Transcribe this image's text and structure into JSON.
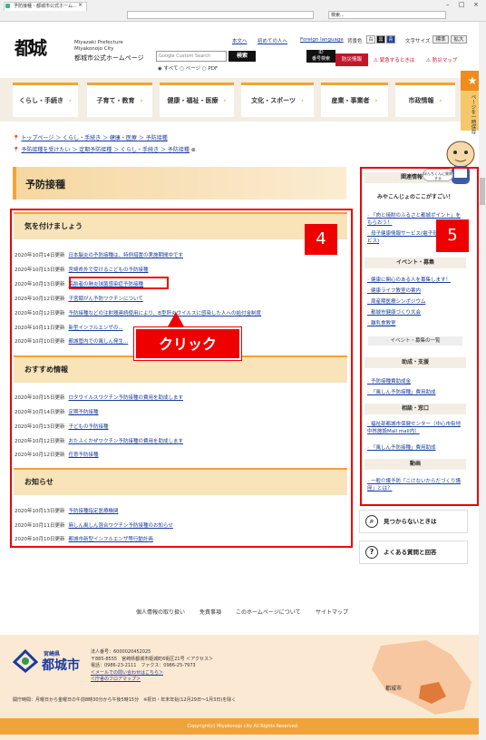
{
  "browser": {
    "tab_title": "予防接種 - 都城市公式ホーム...",
    "tab_close": "×",
    "address": "",
    "search_placeholder": "検索...",
    "window_buttons": [
      "–",
      "□",
      "×"
    ]
  },
  "header": {
    "logo_text": "都城",
    "pref_en": "Miyazaki Prefecture",
    "city_en": "Miyakonojo City",
    "site_title": "都城市公式ホームページ",
    "search_placeholder": "Google   Custom Search",
    "search_button": "検索",
    "radio_options": "◉ すべて  ○ ページ  ○ PDF",
    "id_button": "ID\n番号検索",
    "top_links": [
      "本文へ",
      "初めての人へ",
      "Foreign language"
    ],
    "bgcolor_label": "背景色",
    "bgcolor_options": [
      "白",
      "黒",
      "青"
    ],
    "fontsize_label": "文字サイズ",
    "fontsize_options": [
      "標準",
      "拡大"
    ],
    "bousai": "防災情報",
    "emergency": "緊急するときは",
    "bousai_map": "防災マップ"
  },
  "nav": {
    "items": [
      "くらし・手続き",
      "子育て・教育",
      "健康・福祉・医療",
      "文化・スポーツ",
      "産業・事業者",
      "市政情報"
    ],
    "page_top": "ページを一時保存"
  },
  "breadcrumb": {
    "line1": "トップページ ＞ くらし・手続き ＞ 健康・医療 ＞ 予防接種",
    "line2": "予防接種を受けたい ＞ 定期予防接種 ＞ くらし・手続き ＞ 予防接種"
  },
  "page_title": "予防接種",
  "sections": [
    {
      "heading": "気を付けましょう",
      "rows": [
        {
          "date": "2020年10月14日更新",
          "title": "日本脳炎の予防接種は、特例措置の実施期間中です"
        },
        {
          "date": "2020年10月13日更新",
          "title": "宮崎県外で受けるこどもの予防接種"
        },
        {
          "date": "2020年10月13日更新",
          "title": "高齢者の肺炎球菌感染症予防接種"
        },
        {
          "date": "2020年10月12日更新",
          "title": "子宮頸がん予防ワクチンについて"
        },
        {
          "date": "2020年10月12日更新",
          "title": "予防接種などの注射器連続使用により、B型肝炎ウイルスに感染した人への給付金制度"
        },
        {
          "date": "2020年10月11日更新",
          "title": "新型インフルエンザの..."
        },
        {
          "date": "2020年10月10日更新",
          "title": "都城管内での風しん発生..."
        }
      ]
    },
    {
      "heading": "おすすめ情報",
      "rows": [
        {
          "date": "2020年10月15日更新",
          "title": "ロタウイルスワクチン予防接種の費用を助成します"
        },
        {
          "date": "2020年10月14日更新",
          "title": "定期予防接種"
        },
        {
          "date": "2020年10月13日更新",
          "title": "子どもの予防接種"
        },
        {
          "date": "2020年10月12日更新",
          "title": "おたふくかぜワクチン予防接種の費用を助成します"
        },
        {
          "date": "2020年10月12日更新",
          "title": "任意予防接種"
        }
      ]
    },
    {
      "heading": "お知らせ",
      "rows": [
        {
          "date": "2020年10月13日更新",
          "title": "予防接種指定医療機関"
        },
        {
          "date": "2020年10月11日更新",
          "title": "麻しん風しん混合ワクチン予防接種のお知らせ"
        },
        {
          "date": "2020年10月10日更新",
          "title": "都城市新型インフルエンザ等行動計画"
        }
      ]
    }
  ],
  "annotations": {
    "badge_left": "4",
    "badge_right": "5",
    "click": "クリック"
  },
  "sidebar": {
    "related_heading": "関連情報",
    "bubble": "ぼんちくんに質問する",
    "miyakon_heading": "みやこんじょのここがすごい！",
    "miyakon_links": [
      "「肉と焼酎のふるさと都城ポイント」をもらおう！",
      "母子健康情報サービス(電子母子手帳サービス)"
    ],
    "event_heading": "イベント・募集",
    "event_links": [
      "健康に関心のある人を募集します！",
      "健康ライフ教室の案内",
      "周産期医療シンポジウム",
      "都城市健康づくり大会",
      "離乳食教室"
    ],
    "event_button": "イベント・募集の一覧",
    "subsidy_heading": "助成・支援",
    "subsidy_links": [
      "予防接種費助成金",
      "「風しん予防接種」費用助成"
    ],
    "consult_heading": "相談・窓口",
    "consult_links": [
      "福祉部都城市保健センター（中心市街地中核施設Mall mall内）",
      "「風しん予防接種」費用助成"
    ],
    "video_heading": "動画",
    "video_links": [
      "一般介護予防「こけないからだづくり講座」とは？"
    ],
    "not_found": "見つからないときは",
    "faq": "よくある質問と回答"
  },
  "footer": {
    "links": [
      "個人情報の取り扱い",
      "免責事項",
      "このホームページについて",
      "サイトマップ"
    ],
    "pref": "宮崎県",
    "city": "都城市",
    "info_lines": [
      "法人番号：6000020452025",
      "〒885-8555　宮崎県都城市姫城町6街区21号 ＜アクセス＞",
      "電話：0986-23-2111　ファクス：0986-25-7973",
      "＜メールでの問い合わせはこちら＞",
      "＜庁舎のフロアマップ＞"
    ],
    "hours": "開庁時間：月曜日から金曜日の午前8時30分から午後5時15分　※祝日・年末年始(12月29日〜1月3日)を除く",
    "map_label": "都城市",
    "copyright": "Copyright(c) Miyakonojo city All Rights Reserved."
  },
  "colors": {
    "accent": "#f0a33b",
    "annotation_red": "#e00",
    "link": "#1a3c9c",
    "section_bg": "#f9e3b9"
  }
}
